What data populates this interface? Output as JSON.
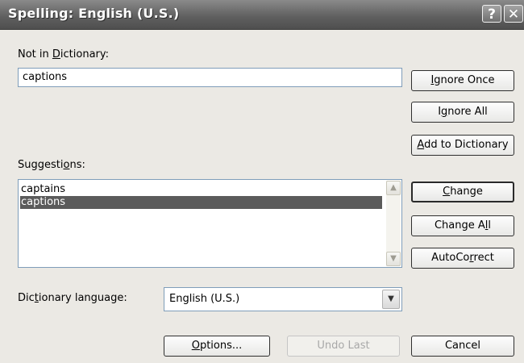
{
  "window": {
    "title": "Spelling: English (U.S.)"
  },
  "titlebar": {
    "help": "?",
    "close": "✕"
  },
  "not_in_dictionary": {
    "label_pre": "Not in ",
    "label_key": "D",
    "label_post": "ictionary:",
    "value": "captions"
  },
  "suggestions": {
    "label_pre": "Suggesti",
    "label_key": "o",
    "label_post": "ns:",
    "items": [
      "captains",
      "captions"
    ],
    "selected": "captions"
  },
  "dictionary_language": {
    "label_pre": "Dic",
    "label_key": "t",
    "label_post": "ionary language:",
    "value": "English (U.S.)"
  },
  "buttons": {
    "ignore_once": {
      "pre": "",
      "key": "I",
      "post": "gnore Once"
    },
    "ignore_all": {
      "pre": "I",
      "key": "g",
      "post": "nore All"
    },
    "add_to_dictionary": {
      "pre": "",
      "key": "A",
      "post": "dd to Dictionary"
    },
    "change": {
      "pre": "",
      "key": "C",
      "post": "hange"
    },
    "change_all": {
      "pre": "Change A",
      "key": "l",
      "post": "l"
    },
    "autocorrect": {
      "pre": "AutoCo",
      "key": "r",
      "post": "rect"
    },
    "options": {
      "pre": "",
      "key": "O",
      "post": "ptions..."
    },
    "undo_last": {
      "label": "Undo Last",
      "enabled": false
    },
    "cancel": {
      "label": "Cancel"
    }
  },
  "icons": {
    "scroll_up": "▲",
    "scroll_down": "▼",
    "dropdown": "▼"
  }
}
